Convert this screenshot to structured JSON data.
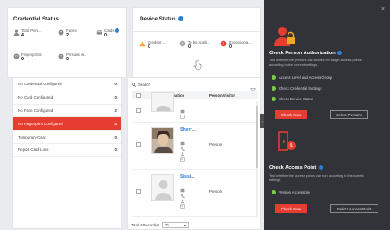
{
  "credential_status": {
    "title": "Credential Status",
    "stats": [
      {
        "label": "Total Pers...",
        "value": "4",
        "icon": "person-icon"
      },
      {
        "label": "Faces",
        "value": "2",
        "icon": "face-icon"
      },
      {
        "label": "Cards",
        "value": "0",
        "icon": "card-icon"
      },
      {
        "label": "Fingerprints",
        "value": "0",
        "icon": "fingerprint-icon"
      },
      {
        "label": "Persons w...",
        "value": "0",
        "icon": "person-icon"
      }
    ]
  },
  "device_status": {
    "title": "Device Status",
    "stats": [
      {
        "label": "Credent ...",
        "value": "0",
        "icon": "warning-icon"
      },
      {
        "label": "To be Appli...",
        "value": "0",
        "icon": "pending-icon"
      },
      {
        "label": "Exceptional...",
        "value": "0",
        "icon": "error-icon"
      }
    ]
  },
  "side_list": [
    {
      "label": "No Credential Configured",
      "count": "0"
    },
    {
      "label": "No Card Configured",
      "count": "0"
    },
    {
      "label": "No Face Configured",
      "count": "2"
    },
    {
      "label": "No Fingerprint Configured",
      "count": "4",
      "active": true
    },
    {
      "label": "Temporary Card",
      "count": "0"
    },
    {
      "label": "Report Card Loss",
      "count": "0"
    }
  ],
  "table": {
    "search_label": "Search",
    "columns": [
      "Basic Information",
      "Person/Visitor"
    ],
    "rows": [
      {
        "name": "",
        "type": ""
      },
      {
        "name": "Sherr...",
        "type": "Person"
      },
      {
        "name": "Sissi...",
        "type": "Person"
      }
    ],
    "footer_label": "Total 4 Record(s)",
    "page_size": "30"
  },
  "guide": {
    "auth_title": "Check Person Authorization",
    "auth_desc": "Test whether the persons can access the target access points according to the current settings.",
    "auth_checks": [
      "Access Level and Access Group",
      "Check Credential Settings",
      "Check Device Status"
    ],
    "auth_btn_primary": "Check Now",
    "auth_btn_secondary": "Select Persons",
    "ap_title": "Check Access Point",
    "ap_desc": "Test whether the access points can run according to the current settings.",
    "ap_checks": [
      "Version Accessible"
    ],
    "ap_btn_primary": "Check Now",
    "ap_btn_secondary": "Select Access Point",
    "close_symbol": "×",
    "collapse_symbol": "‹"
  },
  "colors": {
    "accent": "#e53d2f",
    "link": "#2f7fd6",
    "panel_dark": "#323338",
    "ok_green": "#7ac943"
  }
}
